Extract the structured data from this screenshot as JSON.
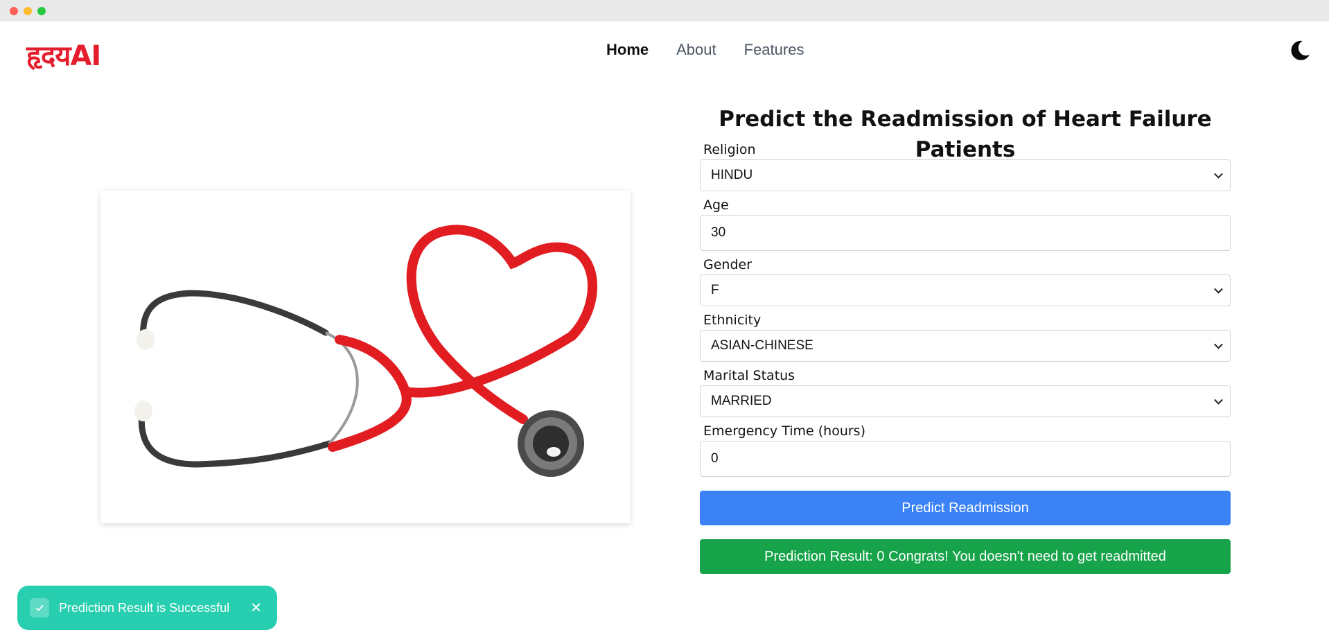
{
  "brand": {
    "logo_text": "हृदयAI",
    "accent": "#e41e2d"
  },
  "nav": {
    "links": [
      {
        "label": "Home",
        "active": true
      },
      {
        "label": "About",
        "active": false
      },
      {
        "label": "Features",
        "active": false
      }
    ],
    "theme_icon": "moon-icon"
  },
  "hero_image": {
    "icon": "heart-stethoscope-illustration"
  },
  "form": {
    "title": "Predict the Readmission of Heart Failure Patients",
    "fields": {
      "religion": {
        "label": "Religion",
        "value": "HINDU"
      },
      "age": {
        "label": "Age",
        "value": "30"
      },
      "gender": {
        "label": "Gender",
        "value": "F"
      },
      "ethnicity": {
        "label": "Ethnicity",
        "value": "ASIAN-CHINESE"
      },
      "marital_status": {
        "label": "Marital Status",
        "value": "MARRIED"
      },
      "emergency_time": {
        "label": "Emergency Time (hours)",
        "value": "0"
      }
    },
    "submit_label": "Predict Readmission",
    "submit_color": "#3b82f6",
    "result_text": "Prediction Result: 0 Congrats! You doesn't need to get readmitted",
    "result_color": "#16a34a"
  },
  "toast": {
    "message": "Prediction Result is Successful",
    "icon": "check-icon",
    "close_icon": "close-icon",
    "color": "#27cfb0"
  }
}
